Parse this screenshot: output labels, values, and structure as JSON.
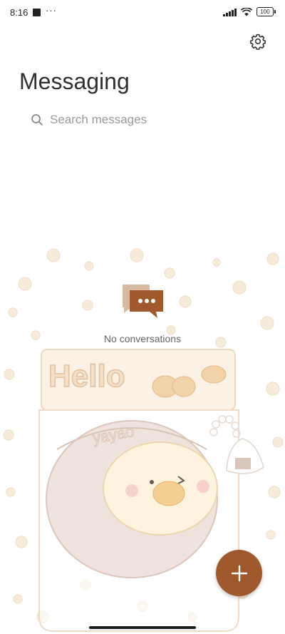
{
  "status_bar": {
    "time": "8:16",
    "overflow_dots": "···",
    "battery_level": "100"
  },
  "header": {
    "title": "Messaging"
  },
  "search": {
    "placeholder": "Search messages"
  },
  "empty_state": {
    "text": "No conversations"
  },
  "wallpaper": {
    "hello_text": "Hello",
    "brand_text": "yayao"
  },
  "icons": {
    "settings": "gear-icon",
    "search": "search-icon",
    "empty": "chat-bubbles-icon",
    "new_message": "plus-icon"
  },
  "colors": {
    "accent": "#a0592c",
    "empty_icon_front": "#a0592c",
    "empty_icon_back": "#d7b9a2",
    "wallpaper_tint": "#f5e6d3"
  }
}
